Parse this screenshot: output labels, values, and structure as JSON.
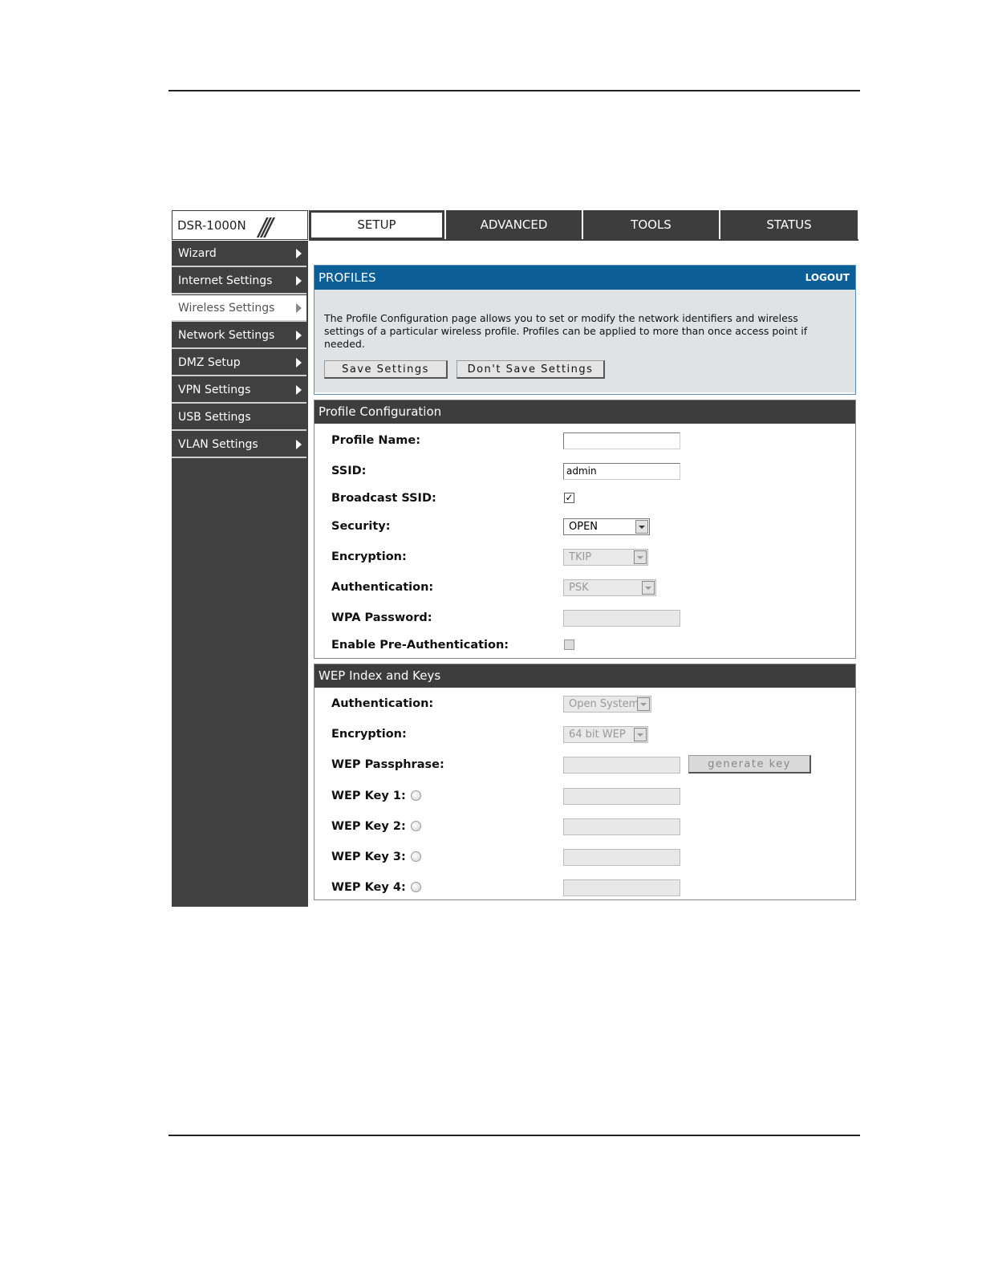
{
  "device": {
    "model": "DSR-1000N"
  },
  "tabs": [
    {
      "label": "SETUP",
      "active": true
    },
    {
      "label": "ADVANCED",
      "active": false
    },
    {
      "label": "TOOLS",
      "active": false
    },
    {
      "label": "STATUS",
      "active": false
    }
  ],
  "sidebar": {
    "items": [
      {
        "label": "Wizard",
        "arrow": true,
        "active": false
      },
      {
        "label": "Internet Settings",
        "arrow": true,
        "active": false
      },
      {
        "label": "Wireless Settings",
        "arrow": true,
        "active": true
      },
      {
        "label": "Network Settings",
        "arrow": true,
        "active": false
      },
      {
        "label": "DMZ Setup",
        "arrow": true,
        "active": false
      },
      {
        "label": "VPN Settings",
        "arrow": true,
        "active": false
      },
      {
        "label": "USB Settings",
        "arrow": false,
        "active": false
      },
      {
        "label": "VLAN Settings",
        "arrow": true,
        "active": false
      }
    ]
  },
  "profiles": {
    "title": "PROFILES",
    "logout_label": "LOGOUT",
    "description": "The Profile Configuration page allows you to set or modify the network identifiers and wireless settings of a particular wireless profile. Profiles can be applied to more than once access point if needed.",
    "save_label": "Save Settings",
    "dont_save_label": "Don't Save Settings"
  },
  "profile_config": {
    "title": "Profile Configuration",
    "profile_name": {
      "label": "Profile Name:",
      "value": ""
    },
    "ssid": {
      "label": "SSID:",
      "value": "admin"
    },
    "broadcast_ssid": {
      "label": "Broadcast SSID:",
      "checked": true,
      "mark": "✓"
    },
    "security": {
      "label": "Security:",
      "value": "OPEN"
    },
    "encryption": {
      "label": "Encryption:",
      "value": "TKIP"
    },
    "authentication": {
      "label": "Authentication:",
      "value": "PSK"
    },
    "wpa_password": {
      "label": "WPA Password:",
      "value": ""
    },
    "pre_auth": {
      "label": "Enable Pre-Authentication:",
      "checked": false
    }
  },
  "wep": {
    "title": "WEP Index and Keys",
    "authentication": {
      "label": "Authentication:",
      "value": "Open System"
    },
    "encryption": {
      "label": "Encryption:",
      "value": "64 bit WEP"
    },
    "passphrase": {
      "label": "WEP Passphrase:",
      "value": ""
    },
    "generate_label": "generate key",
    "keys": [
      {
        "label": "WEP Key 1:",
        "value": ""
      },
      {
        "label": "WEP Key 2:",
        "value": ""
      },
      {
        "label": "WEP Key 3:",
        "value": ""
      },
      {
        "label": "WEP Key 4:",
        "value": ""
      }
    ]
  }
}
